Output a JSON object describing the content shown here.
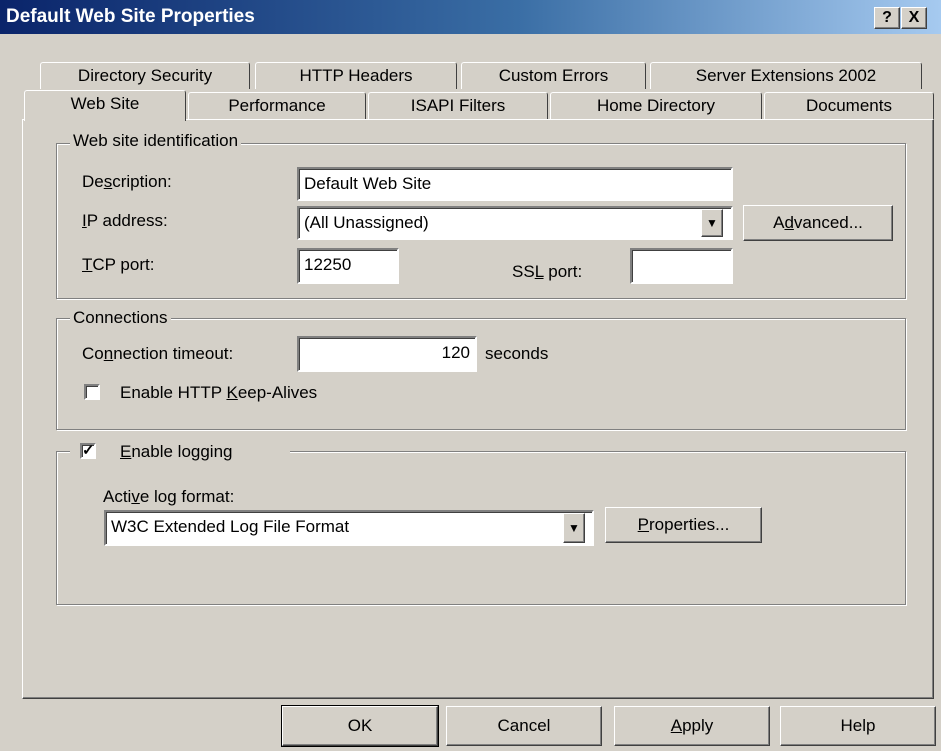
{
  "window": {
    "title": "Default Web Site Properties",
    "help_button": "?",
    "close_button": "X"
  },
  "tabs_back": [
    {
      "label": "Directory Security"
    },
    {
      "label": "HTTP Headers"
    },
    {
      "label": "Custom Errors"
    },
    {
      "label": "Server Extensions 2002"
    }
  ],
  "tabs_front": [
    {
      "label": "Web Site",
      "active": true
    },
    {
      "label": "Performance"
    },
    {
      "label": "ISAPI Filters"
    },
    {
      "label": "Home Directory"
    },
    {
      "label": "Documents"
    }
  ],
  "identification": {
    "legend": "Web site identification",
    "description_label": "Description:",
    "description_value": "Default Web Site",
    "ip_label": "IP address:",
    "ip_value": "(All Unassigned)",
    "advanced_label": "Advanced...",
    "tcp_label": "TCP port:",
    "tcp_value": "12250",
    "ssl_label": "SSL port:",
    "ssl_value": ""
  },
  "connections": {
    "legend": "Connections",
    "timeout_label": "Connection timeout:",
    "timeout_value": "120",
    "timeout_unit": "seconds",
    "keepalive_label": "Enable HTTP Keep-Alives",
    "keepalive_checked": false
  },
  "logging": {
    "enable_label": "Enable logging",
    "enabled": true,
    "format_label": "Active log format:",
    "format_value": "W3C Extended Log File Format",
    "properties_label": "Properties..."
  },
  "buttons": {
    "ok": "OK",
    "cancel": "Cancel",
    "apply": "Apply",
    "help": "Help"
  },
  "colors": {
    "dialog_face": "#d4d0c8",
    "titlebar_start": "#0a246a",
    "titlebar_end": "#a6caf0"
  }
}
